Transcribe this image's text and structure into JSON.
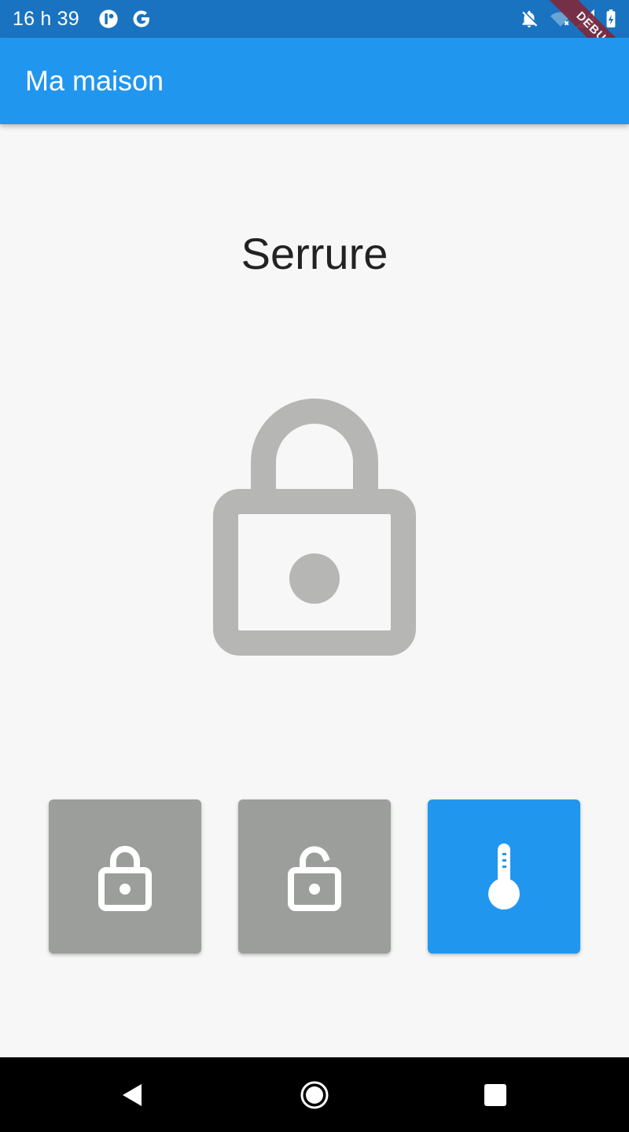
{
  "status_bar": {
    "time": "16 h 39",
    "left_icons": [
      "app-notification-icon",
      "google-icon"
    ],
    "right_icons": [
      "notifications-off-icon",
      "wifi-off-icon",
      "no-signal-icon",
      "battery-charging-icon"
    ],
    "debug_label": "DEBUG"
  },
  "app_bar": {
    "title": "Ma maison"
  },
  "main": {
    "heading": "Serrure",
    "state_icon": "lock-icon"
  },
  "actions": [
    {
      "name": "lock-button",
      "icon": "lock-icon",
      "color": "#9c9e9b"
    },
    {
      "name": "unlock-button",
      "icon": "lock-open-icon",
      "color": "#9c9e9b"
    },
    {
      "name": "temperature-button",
      "icon": "thermometer-icon",
      "color": "#2196ee"
    }
  ],
  "nav_bar": {
    "buttons": [
      "back-icon",
      "home-icon",
      "recents-icon"
    ]
  },
  "colors": {
    "primary": "#2196ee",
    "status_bar": "#1a73c0",
    "background": "#f6f7f6",
    "inactive": "#9c9e9b",
    "icon_gray": "#b6b7b5"
  }
}
